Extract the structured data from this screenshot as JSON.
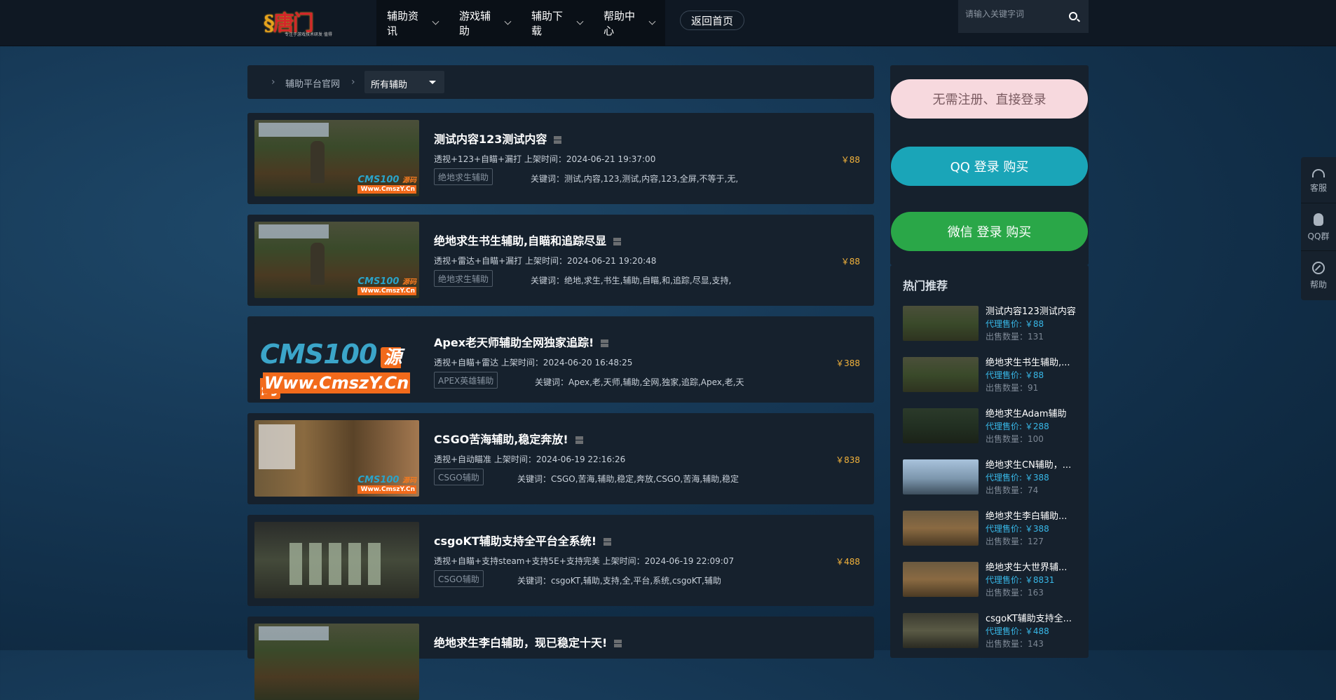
{
  "header": {
    "logo_text": "唐门",
    "logo_tagline": "专注于游戏技术研发 值得",
    "nav": [
      {
        "label": "辅助资讯"
      },
      {
        "label": "游戏辅助"
      },
      {
        "label": "辅助下载"
      },
      {
        "label": "帮助中心"
      }
    ],
    "home_label": "返回首页",
    "search_placeholder": "请输入关键字词"
  },
  "breadcrumb": {
    "link": "辅助平台官网",
    "select_value": "所有辅助"
  },
  "products": [
    {
      "title": "测试内容123测试内容",
      "meta": "透视+123+自瞄+漏打 上架时间：2024-06-21 19:37:00",
      "tag": "绝地求生辅助",
      "keywords": "关键词：测试,内容,123,测试,内容,123,全屏,不等于,无,",
      "price": "￥88"
    },
    {
      "title": "绝地求生书生辅助,自瞄和追踪尽显",
      "meta": "透视+雷达+自瞄+漏打 上架时间：2024-06-21 19:20:48",
      "tag": "绝地求生辅助",
      "keywords": "关键词：绝地,求生,书生,辅助,自瞄,和,追踪,尽显,支持,",
      "price": "￥88"
    },
    {
      "title": "Apex老天师辅助全网独家追踪!",
      "meta": "透视+自瞄+雷达 上架时间：2024-06-20 16:48:25",
      "tag": "APEX英雄辅助",
      "keywords": "关键词：Apex,老,天师,辅助,全网,独家,追踪,Apex,老,天",
      "price": "￥388"
    },
    {
      "title": "CSGO苦海辅助,稳定奔放!",
      "meta": "透视+自动瞄准 上架时间：2024-06-19 22:16:26",
      "tag": "CSGO辅助",
      "keywords": "关键词：CSGO,苦海,辅助,稳定,奔放,CSGO,苦海,辅助,稳定",
      "price": "￥838"
    },
    {
      "title": "csgoKT辅助支持全平台全系统!",
      "meta": "透视+自瞄+支持steam+支持5E+支持完美 上架时间：2024-06-19 22:09:07",
      "tag": "CSGO辅助",
      "keywords": "关键词：csgoKT,辅助,支持,全,平台,系统,csgoKT,辅助",
      "price": "￥488"
    },
    {
      "title": "绝地求生李白辅助，现已稳定十天!",
      "meta": "",
      "tag": "",
      "keywords": "",
      "price": ""
    }
  ],
  "thumb_watermark": {
    "brand": "CMS100",
    "brand_badge": "源码",
    "url": "Www.CmszY.Cn"
  },
  "sidebar": {
    "free_label": "无需注册、直接登录",
    "qq_label": "QQ 登录 购买",
    "wx_label": "微信 登录 购买",
    "hot_title": "热门推荐",
    "hot_items": [
      {
        "name": "测试内容123测试内容",
        "price": "代理售价: ￥88",
        "sold": "出售数量：131"
      },
      {
        "name": "绝地求生书生辅助,...",
        "price": "代理售价: ￥88",
        "sold": "出售数量：91"
      },
      {
        "name": "绝地求生Adam辅助",
        "price": "代理售价: ￥288",
        "sold": "出售数量：100"
      },
      {
        "name": "绝地求生CN辅助，...",
        "price": "代理售价: ￥388",
        "sold": "出售数量：74"
      },
      {
        "name": "绝地求生李白辅助...",
        "price": "代理售价: ￥388",
        "sold": "出售数量：127"
      },
      {
        "name": "绝地求生大世界辅...",
        "price": "代理售价: ￥8831",
        "sold": "出售数量：163"
      },
      {
        "name": "csgoKT辅助支持全...",
        "price": "代理售价: ￥488",
        "sold": "出售数量：143"
      }
    ]
  },
  "float_panel": [
    {
      "label": "客服",
      "icon": "headset-icon"
    },
    {
      "label": "QQ群",
      "icon": "qq-icon"
    },
    {
      "label": "帮助",
      "icon": "compass-icon"
    }
  ]
}
